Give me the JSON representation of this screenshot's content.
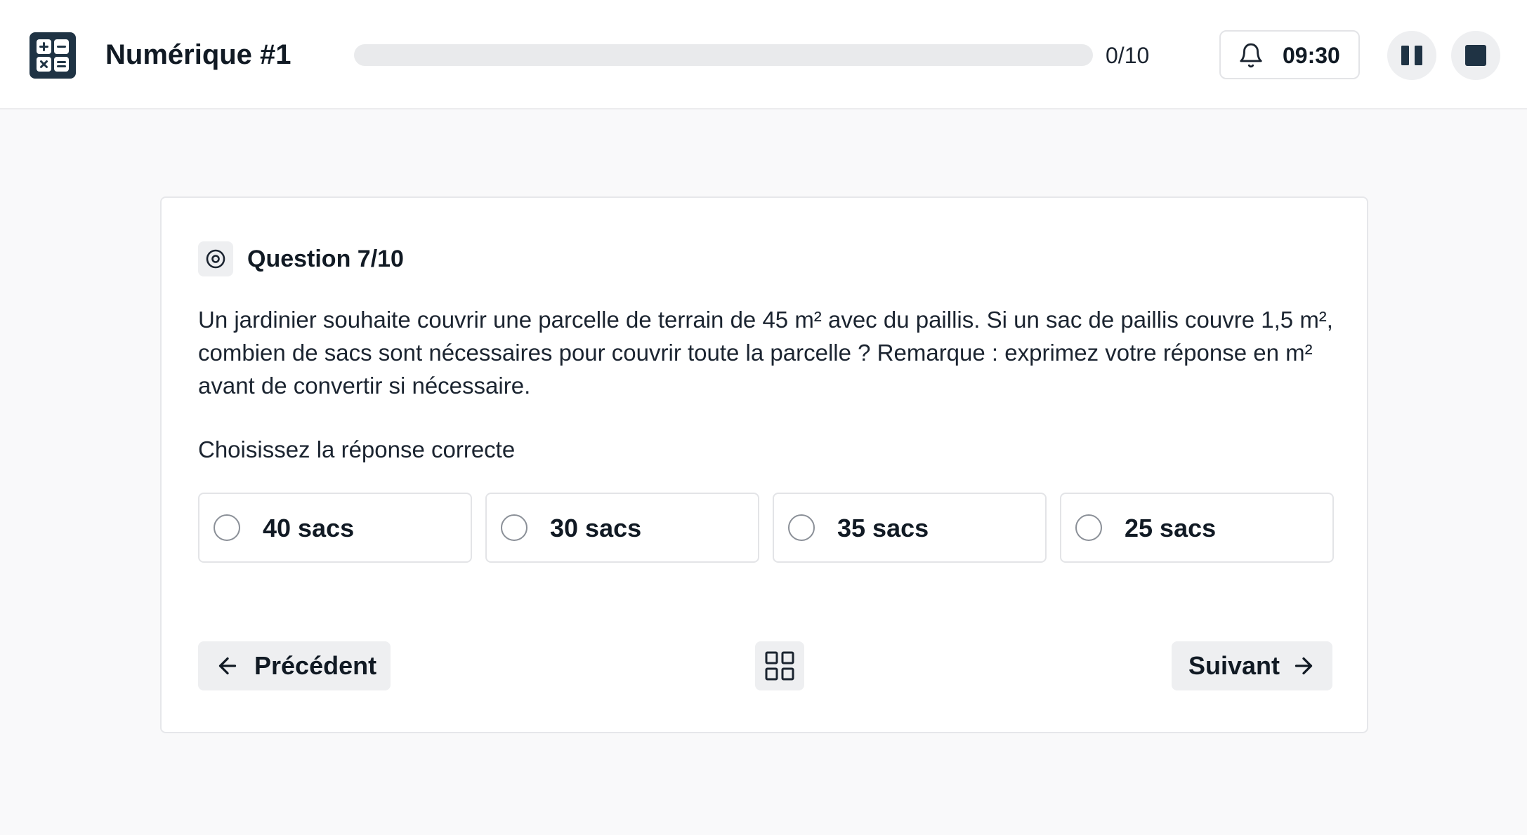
{
  "header": {
    "title": "Numérique #1",
    "logo_icon": "calculator-icon",
    "progress": {
      "answered": 0,
      "total": 10,
      "fraction": 0.0,
      "label": "0/10"
    },
    "timer": {
      "icon": "bell-icon",
      "value": "09:30"
    },
    "controls": {
      "pause_icon": "pause-icon",
      "stop_icon": "stop-icon"
    }
  },
  "question": {
    "icon": "target-icon",
    "number_label": "Question 7/10",
    "text": "Un jardinier souhaite couvrir une parcelle de terrain de 45 m² avec du paillis. Si un sac de paillis couvre 1,5 m², combien de sacs sont nécessaires pour couvrir toute la parcelle ? Remarque : exprimez votre réponse en m² avant de convertir si nécessaire.",
    "instruction": "Choisissez la réponse correcte",
    "options": [
      {
        "label": "40 sacs",
        "selected": false
      },
      {
        "label": "30 sacs",
        "selected": false
      },
      {
        "label": "35 sacs",
        "selected": false
      },
      {
        "label": "25 sacs",
        "selected": false
      }
    ]
  },
  "navigation": {
    "previous_label": "Précédent",
    "previous_icon": "arrow-left-icon",
    "overview_icon": "grid-icon",
    "next_label": "Suivant",
    "next_icon": "arrow-right-icon"
  },
  "colors": {
    "brand": "#1f3344",
    "page_background": "#f9f9fa",
    "text": "#111a24",
    "button_background": "#eeeff1",
    "progress_track": "#e9eaec"
  }
}
